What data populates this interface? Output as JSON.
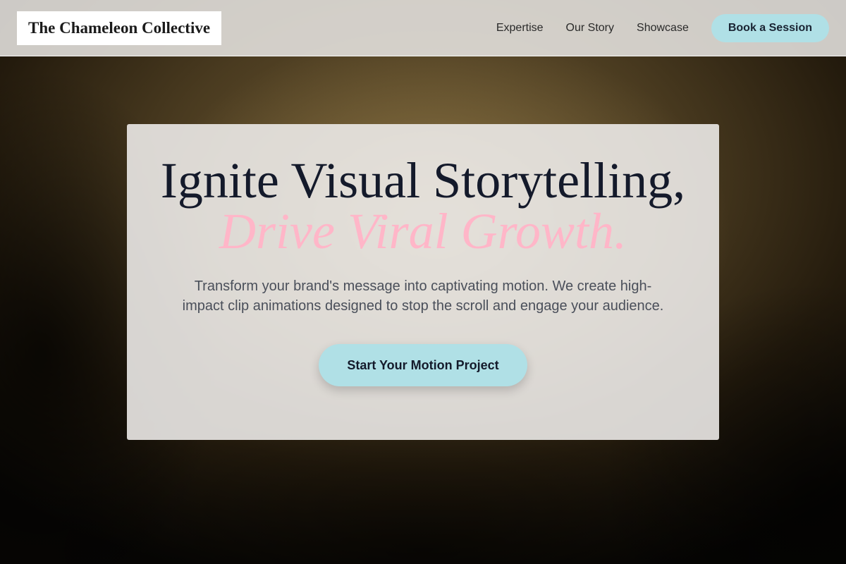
{
  "brand": {
    "name": "The Chameleon Collective"
  },
  "nav": {
    "links": [
      "Expertise",
      "Our Story",
      "Showcase"
    ],
    "cta_label": "Book a Session"
  },
  "hero": {
    "headline_line1": "Ignite Visual Storytelling,",
    "headline_line2": "Drive Viral Growth.",
    "subtext": "Transform your brand's message into captivating motion. We create high-impact clip animations designed to stop the scroll and engage your audience.",
    "cta_label": "Start Your Motion Project"
  },
  "colors": {
    "accent_teal": "#b0e0e6",
    "accent_pink": "#ffb6c8",
    "heading_navy": "#141a2b"
  }
}
